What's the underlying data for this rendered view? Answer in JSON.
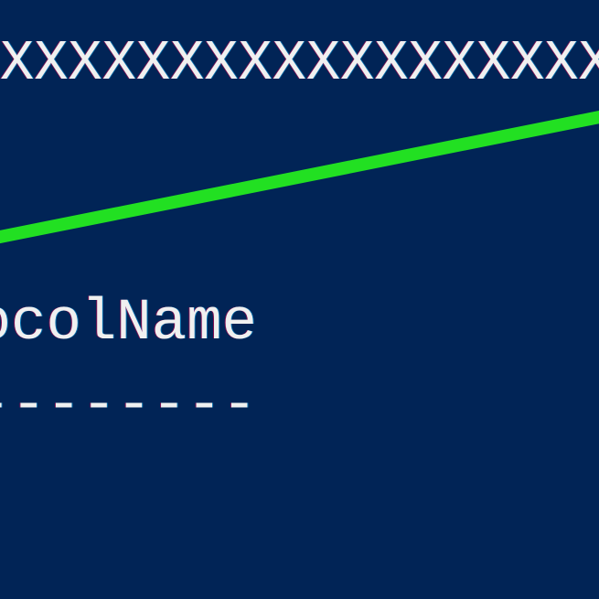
{
  "console": {
    "masked": "XXXXXXXXXXXXXXXXXXX",
    "header": "ProtocolName",
    "dashes": "------------"
  },
  "annotation": {
    "stroke_color": "#22e022"
  }
}
